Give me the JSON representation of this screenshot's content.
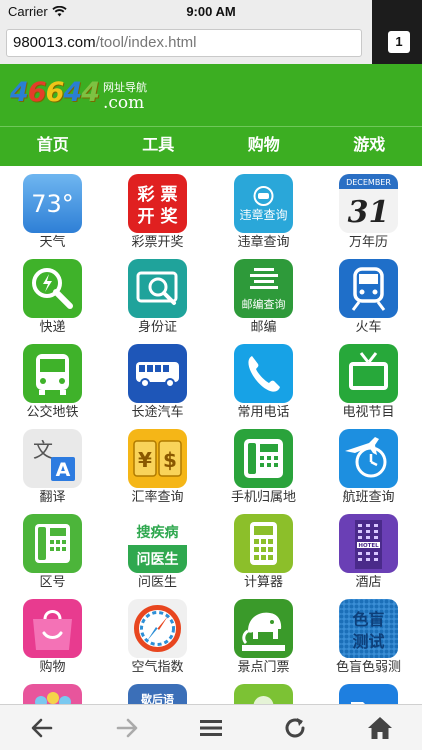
{
  "status_bar": {
    "carrier": "Carrier",
    "time": "9:00 AM",
    "battery_level": 1.0
  },
  "browser": {
    "url_domain": "980013.com",
    "url_path": "/tool/index.html",
    "tab_count": "1"
  },
  "site": {
    "logo_digits": [
      "4",
      "6",
      "6",
      "4",
      "4"
    ],
    "logo_cn": "网址导航",
    "logo_com": ".com"
  },
  "nav": {
    "items": [
      "首页",
      "工具",
      "购物",
      "游戏"
    ]
  },
  "grid": {
    "tiles": [
      {
        "label": "天气",
        "icon": "weather-icon",
        "icon_text": "73°"
      },
      {
        "label": "彩票开奖",
        "icon": "lottery-icon",
        "icon_text_line1": "彩 票",
        "icon_text_line2": "开 奖"
      },
      {
        "label": "违章查询",
        "icon": "traffic-violation-icon",
        "icon_text": "违章查询"
      },
      {
        "label": "万年历",
        "icon": "calendar-icon",
        "icon_text_month": "DECEMBER",
        "icon_text_day": "31"
      },
      {
        "label": "快递",
        "icon": "express-search-icon"
      },
      {
        "label": "身份证",
        "icon": "id-card-icon"
      },
      {
        "label": "邮编",
        "icon": "postcode-icon",
        "icon_text": "邮编查询"
      },
      {
        "label": "火车",
        "icon": "train-icon"
      },
      {
        "label": "公交地铁",
        "icon": "bus-icon"
      },
      {
        "label": "长途汽车",
        "icon": "coach-icon"
      },
      {
        "label": "常用电话",
        "icon": "phone-icon"
      },
      {
        "label": "电视节目",
        "icon": "tv-icon"
      },
      {
        "label": "翻译",
        "icon": "translate-icon",
        "icon_text_cn": "文",
        "icon_text_en": "A"
      },
      {
        "label": "汇率查询",
        "icon": "exchange-rate-icon",
        "icon_text_left": "¥",
        "icon_text_right": "$"
      },
      {
        "label": "手机归属地",
        "icon": "telephone-icon"
      },
      {
        "label": "航班查询",
        "icon": "flight-icon"
      },
      {
        "label": "区号",
        "icon": "area-code-phone-icon"
      },
      {
        "label": "问医生",
        "icon": "doctor-icon",
        "icon_text_line1": "搜疾病",
        "icon_text_line2": "问医生"
      },
      {
        "label": "计算器",
        "icon": "calculator-icon"
      },
      {
        "label": "酒店",
        "icon": "hotel-icon",
        "icon_text": "HOTEL"
      },
      {
        "label": "购物",
        "icon": "shopping-bag-icon"
      },
      {
        "label": "空气指数",
        "icon": "air-index-icon"
      },
      {
        "label": "景点门票",
        "icon": "scenic-ticket-icon"
      },
      {
        "label": "色盲色弱测",
        "icon": "color-blind-test-icon",
        "icon_text_line1": "色盲",
        "icon_text_line2": "测试"
      },
      {
        "label": "",
        "icon": "partial-pink-icon"
      },
      {
        "label": "",
        "icon": "partial-blue-icon",
        "icon_text": "歇后语"
      },
      {
        "label": "",
        "icon": "partial-green-icon"
      },
      {
        "label": "",
        "icon": "partial-folder-icon"
      }
    ]
  },
  "toolbar": {
    "buttons": [
      "back-icon",
      "forward-icon",
      "menu-icon",
      "reload-icon",
      "home-icon"
    ]
  }
}
